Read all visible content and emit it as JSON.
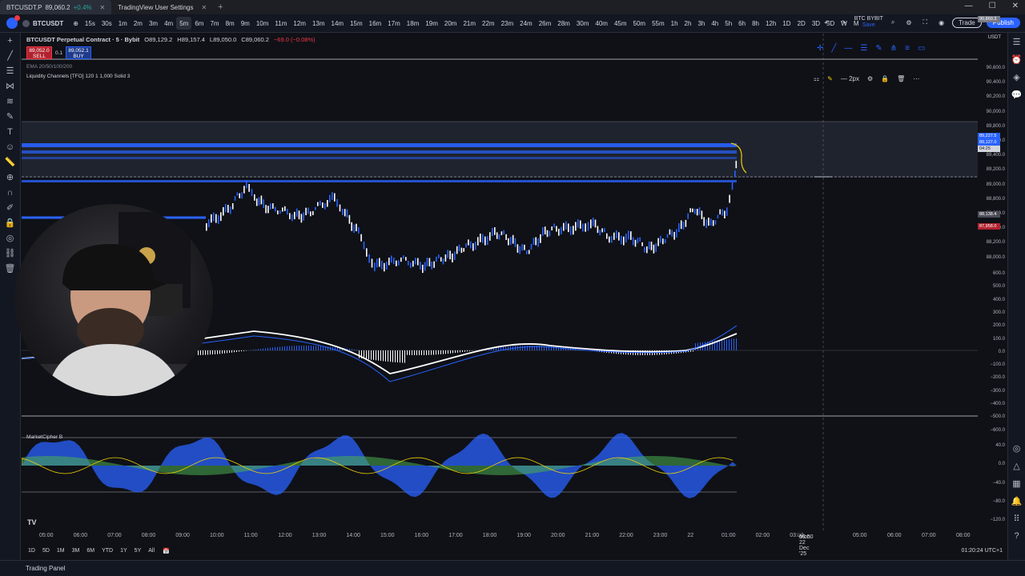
{
  "browser": {
    "tabs": [
      {
        "label": "BTCUSDT.P",
        "price": "89,060.2",
        "change": "+0.4%",
        "active": true
      },
      {
        "label": "TradingView User Settings",
        "active": false
      }
    ]
  },
  "toolbar": {
    "symbol": "BTCUSDT",
    "intervals": [
      "15s",
      "30s",
      "1m",
      "2m",
      "3m",
      "4m",
      "5m",
      "6m",
      "7m",
      "8m",
      "9m",
      "10m",
      "11m",
      "12m",
      "13m",
      "14m",
      "15m",
      "16m",
      "17m",
      "18m",
      "19m",
      "20m",
      "21m",
      "22m",
      "23m",
      "24m",
      "26m",
      "28m",
      "30m",
      "40m",
      "45m",
      "50m",
      "55m",
      "1h",
      "2h",
      "3h",
      "4h",
      "5h",
      "6h",
      "8h",
      "12h",
      "1D",
      "2D",
      "3D",
      "5D",
      "W",
      "M"
    ],
    "selected_interval": "5m",
    "account_line1": "BTC BYBIT",
    "account_line2": "Save",
    "trade_label": "Trade",
    "publish_label": "Publish"
  },
  "legend": {
    "title": "BTCUSDT Perpetual Contract · 5 · Bybit",
    "open": "O89,129.2",
    "high": "H89,157.4",
    "low": "L89,050.0",
    "close": "C89,060.2",
    "change": "−69.0 (−0.08%)",
    "sell_price": "89,052.0",
    "sell_label": "SELL",
    "spread": "0.1",
    "buy_price": "89,052.1",
    "buy_label": "BUY",
    "ema_label": "EMA 20/50/100/200",
    "liquidity_label": "Liquidity Channels [TFO] 120 1 1,000 Solid 3",
    "mc_label": "MarketCipher B"
  },
  "draw_toolbar": {
    "width_label": "2px"
  },
  "price_axis": {
    "currency": "USDT",
    "top_label": "90,860.3",
    "labels": [
      "90,600.0",
      "90,400.0",
      "90,200.0",
      "90,000.0",
      "89,800.0",
      "89,600.0",
      "89,400.0",
      "89,200.0",
      "89,000.0",
      "88,800.0",
      "88,600.0",
      "88,400.0",
      "88,200.0",
      "88,000.0"
    ],
    "current_label": "89,227.5",
    "last_label": "89,127.0",
    "last_sub": "04:25",
    "low_label1": "88,138.4",
    "low_label2": "87,958.0",
    "macd_labels": [
      "600.0",
      "500.0",
      "400.0",
      "300.0",
      "200.0",
      "100.0",
      "0.0",
      "−100.0",
      "−200.0",
      "−300.0",
      "−400.0",
      "−500.0",
      "−600.0"
    ],
    "mc_labels": [
      "40.0",
      "0.0",
      "−40.0",
      "−80.0",
      "−120.0"
    ]
  },
  "time_axis": {
    "labels": [
      "05:00",
      "06:00",
      "07:00",
      "08:00",
      "09:00",
      "10:00",
      "11:00",
      "12:00",
      "13:00",
      "14:00",
      "15:00",
      "16:00",
      "17:00",
      "18:00",
      "19:00",
      "20:00",
      "21:00",
      "22:00",
      "23:00",
      "22",
      "01:00",
      "02:00",
      "03:00",
      "05:00",
      "06:00",
      "07:00",
      "08:00"
    ],
    "cursor_date": "Mon 22 Dec '25",
    "cursor_time": "03:50"
  },
  "bottom": {
    "ranges": [
      "1D",
      "5D",
      "1M",
      "3M",
      "6M",
      "YTD",
      "1Y",
      "5Y",
      "All"
    ],
    "clock": "01:20:24 UTC+1",
    "panel": "Trading Panel"
  },
  "colors": {
    "background": "#0f1117",
    "bull": "#2962ff",
    "bear": "#ffffff",
    "accent": "#2962ff",
    "sell": "#f23645"
  }
}
